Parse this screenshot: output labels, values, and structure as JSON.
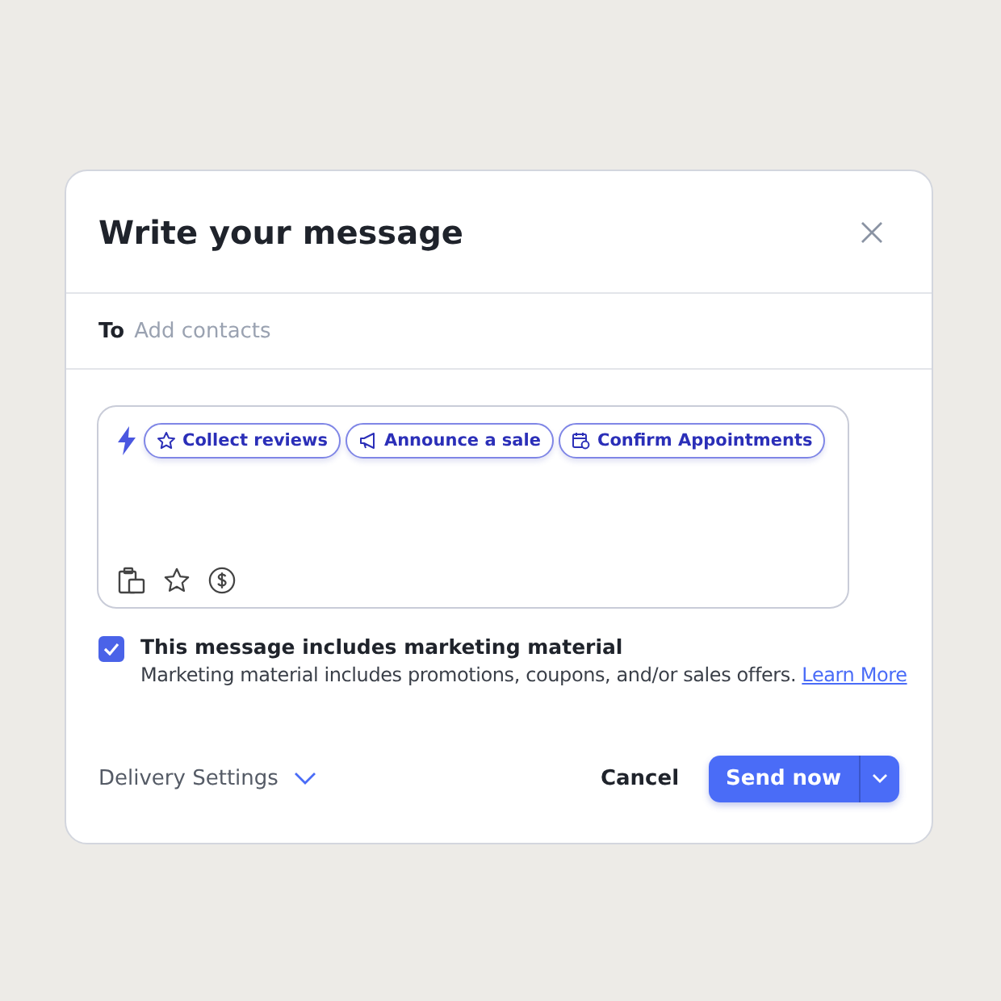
{
  "dialog": {
    "title": "Write your message"
  },
  "recipients": {
    "label": "To",
    "placeholder": "Add contacts"
  },
  "templates": [
    {
      "label": "Collect reviews",
      "kind": "star"
    },
    {
      "label": "Announce a sale",
      "kind": "megaphone"
    },
    {
      "label": "Confirm Appointments",
      "kind": "calendar"
    }
  ],
  "marketing": {
    "checked": true,
    "label": "This message includes marketing material",
    "note": "Marketing material includes promotions, coupons, and/or sales offers.",
    "link": "Learn More"
  },
  "footer": {
    "delivery": "Delivery Settings",
    "cancel": "Cancel",
    "send": "Send now"
  }
}
